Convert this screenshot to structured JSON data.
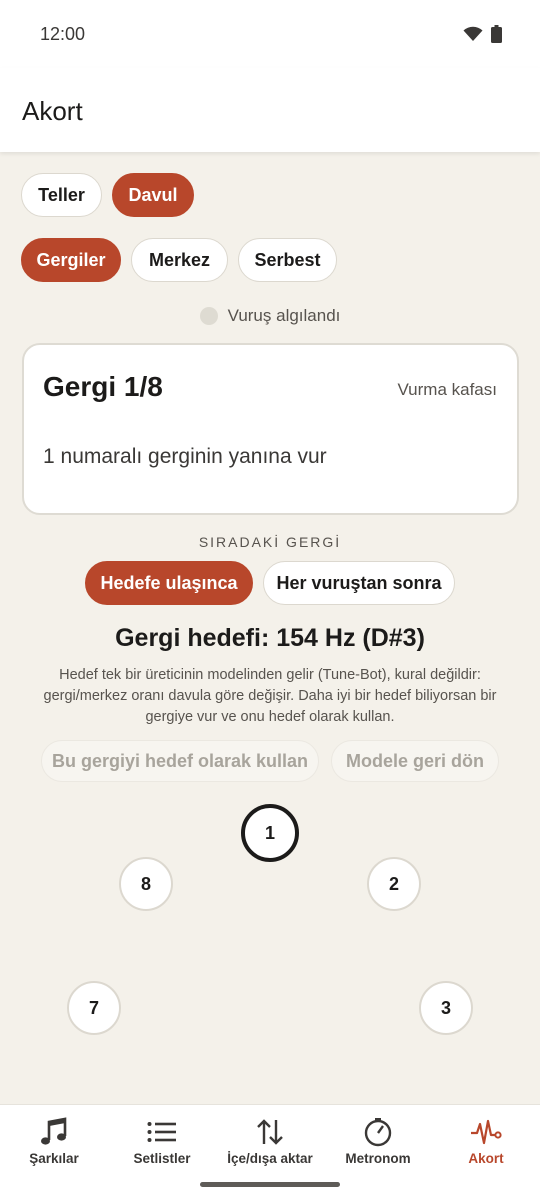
{
  "status": {
    "time": "12:00"
  },
  "app": {
    "title": "Akort"
  },
  "instrument_tabs": [
    {
      "label": "Teller",
      "active": false
    },
    {
      "label": "Davul",
      "active": true
    }
  ],
  "mode_tabs": [
    {
      "label": "Gergiler",
      "active": true
    },
    {
      "label": "Merkez",
      "active": false
    },
    {
      "label": "Serbest",
      "active": false
    }
  ],
  "hit_indicator": {
    "label": "Vuruş algılandı"
  },
  "card": {
    "title": "Gergi 1/8",
    "tag": "Vurma kafası",
    "instruction": "1 numaralı gerginin yanına vur"
  },
  "next_lug": {
    "section_label": "SIRADAKİ GERGİ",
    "options": [
      {
        "label": "Hedefe ulaşınca",
        "active": true
      },
      {
        "label": "Her vuruştan sonra",
        "active": false
      }
    ]
  },
  "target": {
    "title": "Gergi hedefi: 154 Hz (D#3)",
    "description": "Hedef tek bir üreticinin modelinden gelir (Tune-Bot), kural değildir: gergi/merkez oranı davula göre değişir. Daha iyi bir hedef biliyorsan bir gergiye vur ve onu hedef olarak kullan.",
    "use_lug_button": "Bu gergiyi hedef olarak kullan",
    "revert_button": "Modele geri dön"
  },
  "lugs": [
    "1",
    "2",
    "3",
    "7",
    "8"
  ],
  "current_lug": "1",
  "nav": [
    {
      "label": "Şarkılar",
      "icon": "music-note-icon",
      "active": false
    },
    {
      "label": "Setlistler",
      "icon": "list-icon",
      "active": false
    },
    {
      "label": "İçe/dışa aktar",
      "icon": "import-export-icon",
      "active": false
    },
    {
      "label": "Metronom",
      "icon": "metronome-icon",
      "active": false
    },
    {
      "label": "Akort",
      "icon": "tuner-waveform-icon",
      "active": true
    }
  ],
  "colors": {
    "accent": "#b8472b",
    "background": "#f4f1ea",
    "surface": "#ffffff"
  }
}
